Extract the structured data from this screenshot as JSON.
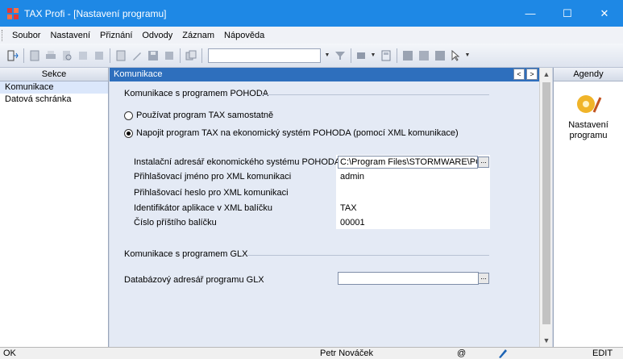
{
  "titlebar": {
    "title": "TAX Profi - [Nastavení programu]",
    "minimize": "—",
    "maximize": "☐",
    "close": "✕"
  },
  "menu": {
    "items": [
      "Soubor",
      "Nastavení",
      "Přiznání",
      "Odvody",
      "Záznam",
      "Nápověda"
    ]
  },
  "left_panel": {
    "header": "Sekce",
    "items": [
      "Komunikace",
      "Datová schránka"
    ]
  },
  "main": {
    "header": "Komunikace",
    "nav_prev": "<",
    "nav_next": ">",
    "pohoda": {
      "group_title": "Komunikace s programem POHODA",
      "radio_standalone": "Používat program TAX samostatně",
      "radio_connect": "Napojit program TAX na ekonomický systém POHODA (pomocí XML komunikace)",
      "fields": [
        {
          "label": "Instalační adresář ekonomického systému POHODA",
          "value": "C:\\Program Files\\STORMWARE\\POH"
        },
        {
          "label": "Přihlašovací jméno pro XML komunikaci",
          "value": "admin"
        },
        {
          "label": "Přihlašovací heslo pro XML komunikaci",
          "value": ""
        },
        {
          "label": "Identifikátor aplikace v XML balíčku",
          "value": "TAX"
        },
        {
          "label": "Číslo příštího balíčku",
          "value": "00001"
        }
      ],
      "browse": "..."
    },
    "glx": {
      "group_title": "Komunikace s programem GLX",
      "field_label": "Databázový adresář programu GLX",
      "field_value": "",
      "browse": "..."
    }
  },
  "right_panel": {
    "header": "Agendy",
    "item_label_1": "Nastavení",
    "item_label_2": "programu"
  },
  "statusbar": {
    "left": "OK",
    "user": "Petr Nováček",
    "at": "@",
    "mode": "EDIT"
  }
}
